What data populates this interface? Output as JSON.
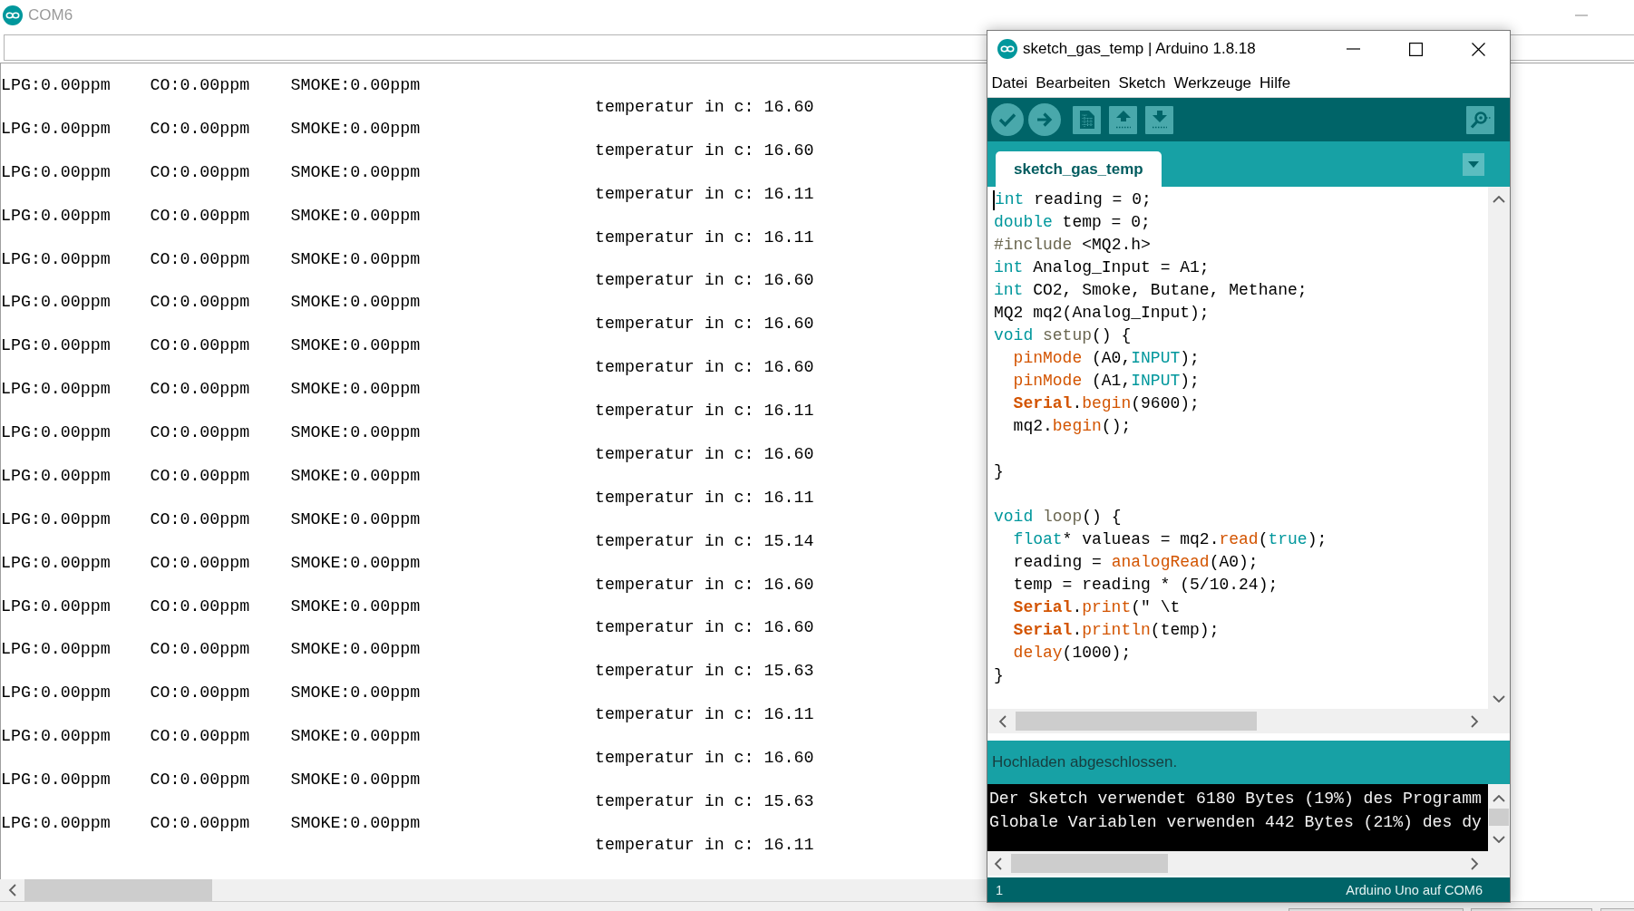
{
  "serial_monitor": {
    "title": "COM6",
    "lines": [
      {
        "lpg": "LPG:0.00ppm",
        "co": "CO:0.00ppm",
        "smoke": "SMOKE:0.00ppm",
        "temperature": "temperatur in c: 16.60"
      },
      {
        "lpg": "LPG:0.00ppm",
        "co": "CO:0.00ppm",
        "smoke": "SMOKE:0.00ppm",
        "temperature": "temperatur in c: 16.60"
      },
      {
        "lpg": "LPG:0.00ppm",
        "co": "CO:0.00ppm",
        "smoke": "SMOKE:0.00ppm",
        "temperature": "temperatur in c: 16.11"
      },
      {
        "lpg": "LPG:0.00ppm",
        "co": "CO:0.00ppm",
        "smoke": "SMOKE:0.00ppm",
        "temperature": "temperatur in c: 16.11"
      },
      {
        "lpg": "LPG:0.00ppm",
        "co": "CO:0.00ppm",
        "smoke": "SMOKE:0.00ppm",
        "temperature": "temperatur in c: 16.60"
      },
      {
        "lpg": "LPG:0.00ppm",
        "co": "CO:0.00ppm",
        "smoke": "SMOKE:0.00ppm",
        "temperature": "temperatur in c: 16.60"
      },
      {
        "lpg": "LPG:0.00ppm",
        "co": "CO:0.00ppm",
        "smoke": "SMOKE:0.00ppm",
        "temperature": "temperatur in c: 16.60"
      },
      {
        "lpg": "LPG:0.00ppm",
        "co": "CO:0.00ppm",
        "smoke": "SMOKE:0.00ppm",
        "temperature": "temperatur in c: 16.11"
      },
      {
        "lpg": "LPG:0.00ppm",
        "co": "CO:0.00ppm",
        "smoke": "SMOKE:0.00ppm",
        "temperature": "temperatur in c: 16.60"
      },
      {
        "lpg": "LPG:0.00ppm",
        "co": "CO:0.00ppm",
        "smoke": "SMOKE:0.00ppm",
        "temperature": "temperatur in c: 16.11"
      },
      {
        "lpg": "LPG:0.00ppm",
        "co": "CO:0.00ppm",
        "smoke": "SMOKE:0.00ppm",
        "temperature": "temperatur in c: 15.14"
      },
      {
        "lpg": "LPG:0.00ppm",
        "co": "CO:0.00ppm",
        "smoke": "SMOKE:0.00ppm",
        "temperature": "temperatur in c: 16.60"
      },
      {
        "lpg": "LPG:0.00ppm",
        "co": "CO:0.00ppm",
        "smoke": "SMOKE:0.00ppm",
        "temperature": "temperatur in c: 16.60"
      },
      {
        "lpg": "LPG:0.00ppm",
        "co": "CO:0.00ppm",
        "smoke": "SMOKE:0.00ppm",
        "temperature": "temperatur in c: 15.63"
      },
      {
        "lpg": "LPG:0.00ppm",
        "co": "CO:0.00ppm",
        "smoke": "SMOKE:0.00ppm",
        "temperature": "temperatur in c: 16.11"
      },
      {
        "lpg": "LPG:0.00ppm",
        "co": "CO:0.00ppm",
        "smoke": "SMOKE:0.00ppm",
        "temperature": "temperatur in c: 16.60"
      },
      {
        "lpg": "LPG:0.00ppm",
        "co": "CO:0.00ppm",
        "smoke": "SMOKE:0.00ppm",
        "temperature": "temperatur in c: 15.63"
      },
      {
        "lpg": "LPG:0.00ppm",
        "co": "CO:0.00ppm",
        "smoke": "SMOKE:0.00ppm",
        "temperature": "temperatur in c: 16.11"
      }
    ]
  },
  "ide": {
    "title": "sketch_gas_temp | Arduino 1.8.18",
    "menu": [
      "Datei",
      "Bearbeiten",
      "Sketch",
      "Werkzeuge",
      "Hilfe"
    ],
    "tabs": [
      {
        "label": "sketch_gas_temp",
        "selected": true
      }
    ],
    "code": [
      {
        "kind": "code",
        "cursor": true,
        "indent": false,
        "tokens": [
          {
            "kind": "keyword",
            "text": "int"
          },
          {
            "kind": "plain",
            "text": " reading = 0;"
          }
        ]
      },
      {
        "kind": "code",
        "cursor": false,
        "indent": false,
        "tokens": [
          {
            "kind": "keyword",
            "text": "double"
          },
          {
            "kind": "plain",
            "text": " temp = 0;"
          }
        ]
      },
      {
        "kind": "code",
        "cursor": false,
        "indent": false,
        "tokens": [
          {
            "kind": "preprocessor",
            "text": "#include"
          },
          {
            "kind": "plain",
            "text": " <MQ2.h>"
          }
        ]
      },
      {
        "kind": "code",
        "cursor": false,
        "indent": false,
        "tokens": [
          {
            "kind": "keyword",
            "text": "int"
          },
          {
            "kind": "plain",
            "text": " Analog_Input = A1;"
          }
        ]
      },
      {
        "kind": "code",
        "cursor": false,
        "indent": false,
        "tokens": [
          {
            "kind": "keyword",
            "text": "int"
          },
          {
            "kind": "plain",
            "text": " CO2, Smoke, Butane, Methane;"
          }
        ]
      },
      {
        "kind": "code",
        "cursor": false,
        "indent": false,
        "tokens": [
          {
            "kind": "plain",
            "text": "MQ2 mq2(Analog_Input);"
          }
        ]
      },
      {
        "kind": "code",
        "cursor": false,
        "indent": false,
        "tokens": [
          {
            "kind": "keyword",
            "text": "void"
          },
          {
            "kind": "structure",
            "text": " setup"
          },
          {
            "kind": "plain",
            "text": "() {"
          }
        ]
      },
      {
        "kind": "code",
        "cursor": false,
        "indent": true,
        "tokens": [
          {
            "kind": "function",
            "text": "pinMode"
          },
          {
            "kind": "plain",
            "text": " (A0,"
          },
          {
            "kind": "constant",
            "text": "INPUT"
          },
          {
            "kind": "plain",
            "text": ");"
          }
        ]
      },
      {
        "kind": "code",
        "cursor": false,
        "indent": true,
        "tokens": [
          {
            "kind": "function",
            "text": "pinMode"
          },
          {
            "kind": "plain",
            "text": " (A1,"
          },
          {
            "kind": "constant",
            "text": "INPUT"
          },
          {
            "kind": "plain",
            "text": ");"
          }
        ]
      },
      {
        "kind": "code",
        "cursor": false,
        "indent": true,
        "tokens": [
          {
            "kind": "class",
            "text": "Serial"
          },
          {
            "kind": "plain",
            "text": "."
          },
          {
            "kind": "function",
            "text": "begin"
          },
          {
            "kind": "plain",
            "text": "(9600);"
          }
        ]
      },
      {
        "kind": "code",
        "cursor": false,
        "indent": true,
        "tokens": [
          {
            "kind": "plain",
            "text": "mq2."
          },
          {
            "kind": "function",
            "text": "begin"
          },
          {
            "kind": "plain",
            "text": "();"
          }
        ]
      },
      {
        "kind": "blank"
      },
      {
        "kind": "code",
        "cursor": false,
        "indent": false,
        "tokens": [
          {
            "kind": "plain",
            "text": "}"
          }
        ]
      },
      {
        "kind": "blank"
      },
      {
        "kind": "code",
        "cursor": false,
        "indent": false,
        "tokens": [
          {
            "kind": "keyword",
            "text": "void"
          },
          {
            "kind": "structure",
            "text": " loop"
          },
          {
            "kind": "plain",
            "text": "() {"
          }
        ]
      },
      {
        "kind": "code",
        "cursor": false,
        "indent": true,
        "tokens": [
          {
            "kind": "keyword",
            "text": "float"
          },
          {
            "kind": "plain",
            "text": "* valueas = mq2."
          },
          {
            "kind": "function",
            "text": "read"
          },
          {
            "kind": "plain",
            "text": "("
          },
          {
            "kind": "constant",
            "text": "true"
          },
          {
            "kind": "plain",
            "text": ");"
          }
        ]
      },
      {
        "kind": "code",
        "cursor": false,
        "indent": true,
        "tokens": [
          {
            "kind": "plain",
            "text": "reading = "
          },
          {
            "kind": "function",
            "text": "analogRead"
          },
          {
            "kind": "plain",
            "text": "(A0);"
          }
        ]
      },
      {
        "kind": "code",
        "cursor": false,
        "indent": true,
        "tokens": [
          {
            "kind": "plain",
            "text": "temp = reading * (5/10.24);"
          }
        ]
      },
      {
        "kind": "code",
        "cursor": false,
        "indent": true,
        "tokens": [
          {
            "kind": "class",
            "text": "Serial"
          },
          {
            "kind": "plain",
            "text": "."
          },
          {
            "kind": "function",
            "text": "print"
          },
          {
            "kind": "plain",
            "text": "(\" \\t"
          }
        ]
      },
      {
        "kind": "code",
        "cursor": false,
        "indent": true,
        "tokens": [
          {
            "kind": "class",
            "text": "Serial"
          },
          {
            "kind": "plain",
            "text": "."
          },
          {
            "kind": "function",
            "text": "println"
          },
          {
            "kind": "plain",
            "text": "(temp);"
          }
        ]
      },
      {
        "kind": "code",
        "cursor": false,
        "indent": true,
        "tokens": [
          {
            "kind": "function",
            "text": "delay"
          },
          {
            "kind": "plain",
            "text": "(1000);"
          }
        ]
      },
      {
        "kind": "code",
        "cursor": false,
        "indent": false,
        "tokens": [
          {
            "kind": "plain",
            "text": "}"
          }
        ]
      }
    ],
    "status_message": "Hochladen abgeschlossen.",
    "console": [
      "Der Sketch verwendet 6180 Bytes (19%) des Programm",
      "Globale Variablen verwenden 442 Bytes (21%) des dy"
    ],
    "footer": {
      "line": "1",
      "board": "Arduino Uno auf COM6"
    }
  }
}
